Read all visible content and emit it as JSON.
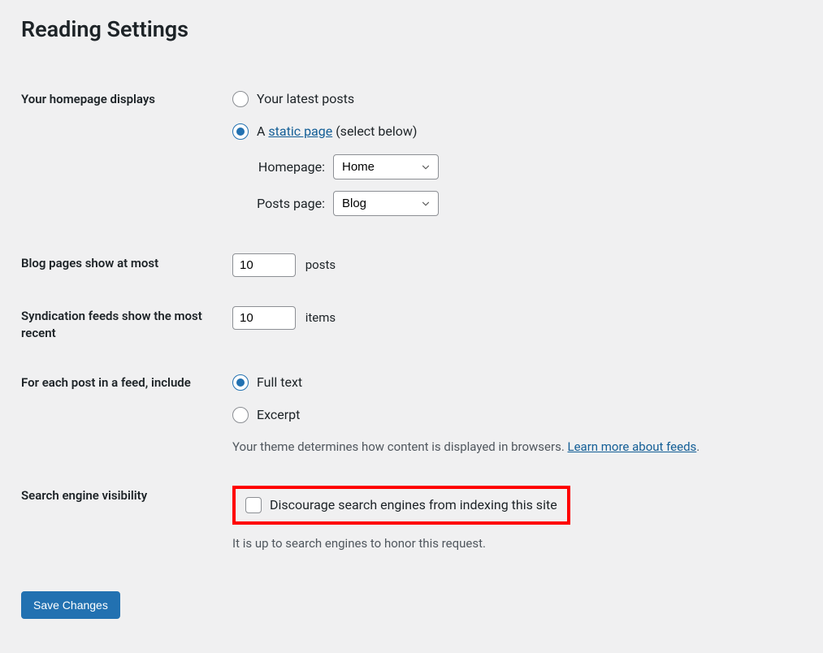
{
  "page_title": "Reading Settings",
  "homepage_displays": {
    "th": "Your homepage displays",
    "radio_latest": "Your latest posts",
    "radio_static_prefix": "A ",
    "radio_static_link": "static page",
    "radio_static_suffix": " (select below)",
    "selected": "static",
    "homepage_label": "Homepage:",
    "homepage_value": "Home",
    "postspage_label": "Posts page:",
    "postspage_value": "Blog"
  },
  "blog_pages": {
    "th": "Blog pages show at most",
    "value": "10",
    "suffix": "posts"
  },
  "syndication": {
    "th": "Syndication feeds show the most recent",
    "value": "10",
    "suffix": "items"
  },
  "feed_content": {
    "th": "For each post in a feed, include",
    "full_text": "Full text",
    "excerpt": "Excerpt",
    "selected": "full",
    "description_prefix": "Your theme determines how content is displayed in browsers. ",
    "description_link": "Learn more about feeds",
    "description_suffix": "."
  },
  "search_visibility": {
    "th": "Search engine visibility",
    "checkbox_label": "Discourage search engines from indexing this site",
    "description": "It is up to search engines to honor this request."
  },
  "save_button": "Save Changes"
}
